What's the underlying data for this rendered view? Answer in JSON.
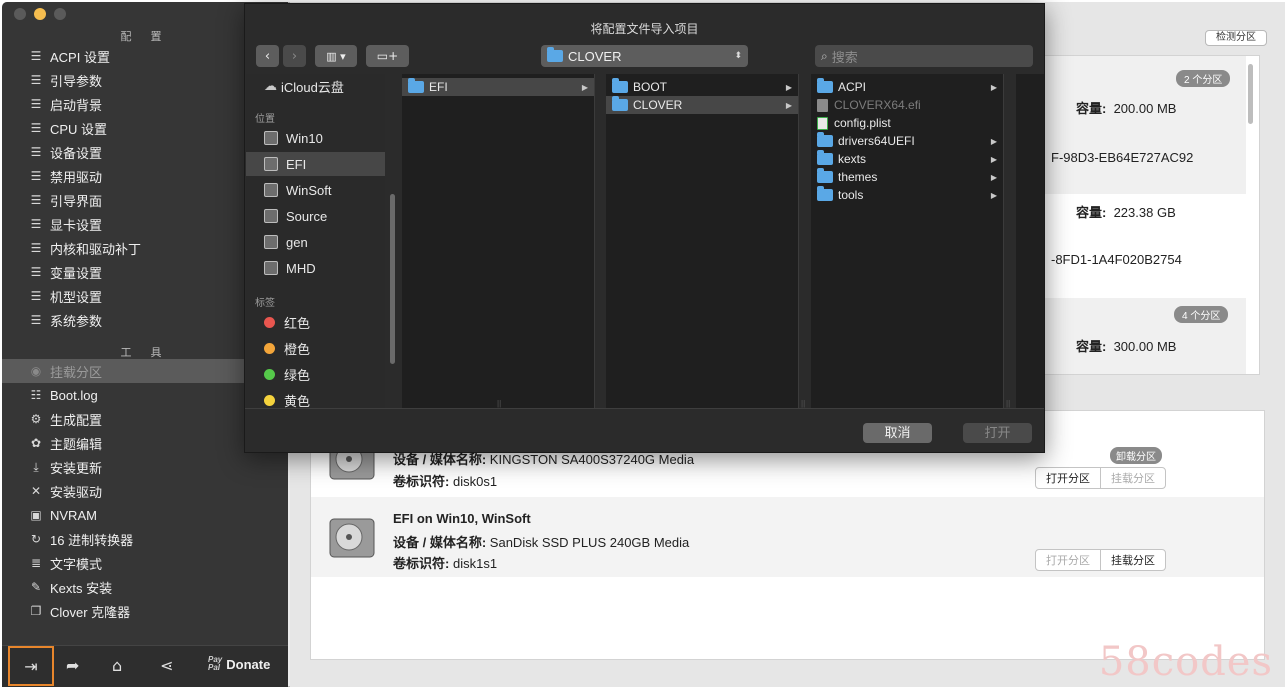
{
  "sidebar": {
    "section_config": "配 置",
    "section_tools": "工 具",
    "config_items": [
      {
        "icon": "list-icon",
        "label": "ACPI 设置"
      },
      {
        "icon": "list-icon",
        "label": "引导参数"
      },
      {
        "icon": "list-icon",
        "label": "启动背景"
      },
      {
        "icon": "list-icon",
        "label": "CPU 设置"
      },
      {
        "icon": "list-icon",
        "label": "设备设置"
      },
      {
        "icon": "list-icon",
        "label": "禁用驱动"
      },
      {
        "icon": "list-icon",
        "label": "引导界面"
      },
      {
        "icon": "list-icon",
        "label": "显卡设置"
      },
      {
        "icon": "list-icon",
        "label": "内核和驱动补丁"
      },
      {
        "icon": "list-icon",
        "label": "变量设置"
      },
      {
        "icon": "list-icon",
        "label": "机型设置"
      },
      {
        "icon": "list-icon",
        "label": "系统参数"
      }
    ],
    "tool_items": [
      {
        "icon": "disk-icon",
        "label": "挂载分区"
      },
      {
        "icon": "log-icon",
        "label": "Boot.log"
      },
      {
        "icon": "gears-icon",
        "label": "生成配置"
      },
      {
        "icon": "palette-icon",
        "label": "主题编辑"
      },
      {
        "icon": "download-icon",
        "label": "安装更新"
      },
      {
        "icon": "tools-icon",
        "label": "安装驱动"
      },
      {
        "icon": "chip-icon",
        "label": "NVRAM"
      },
      {
        "icon": "refresh-icon",
        "label": "16 进制转换器"
      },
      {
        "icon": "text-icon",
        "label": "文字模式"
      },
      {
        "icon": "bolt-icon",
        "label": "Kexts 安装"
      },
      {
        "icon": "clone-icon",
        "label": "Clover 克隆器"
      }
    ],
    "bottom": {
      "paypal_top": "Pay",
      "paypal_bottom": "Pal",
      "donate": "Donate"
    }
  },
  "main": {
    "detect_button": "检测分区",
    "top_rows": [
      {
        "badge": "2 个分区",
        "capacity_label": "容量:",
        "capacity": "200.00 MB",
        "uuid": "F-98D3-EB64E727AC92"
      },
      {
        "capacity_label": "容量:",
        "capacity": "223.38 GB",
        "uuid": "-8FD1-1A4F020B2754"
      },
      {
        "badge": "4 个分区",
        "capacity_label": "容量:",
        "capacity": "300.00 MB"
      }
    ],
    "disks": [
      {
        "title": "",
        "device_label": "设备 / 媒体名称:",
        "device": "KINGSTON SA400S37240G Media",
        "volume_label": "卷标识符:",
        "volume": "disk0s1",
        "badge": "卸载分区",
        "open": "打开分区",
        "mount": "挂载分区"
      },
      {
        "title": "EFI on Win10, WinSoft",
        "device_label": "设备 / 媒体名称:",
        "device": "SanDisk SSD PLUS 240GB Media",
        "volume_label": "卷标识符:",
        "volume": "disk1s1",
        "open": "打开分区",
        "mount": "挂载分区"
      }
    ]
  },
  "dialog": {
    "title": "将配置文件导入项目",
    "path": "CLOVER",
    "search_placeholder": "搜索",
    "sidebar": {
      "icloud": "iCloud云盘",
      "locations_head": "位置",
      "locations": [
        "Win10",
        "EFI",
        "WinSoft",
        "Source",
        "gen",
        "MHD"
      ],
      "tags_head": "标签",
      "tags": [
        {
          "label": "红色",
          "color": "#e9564f"
        },
        {
          "label": "橙色",
          "color": "#f3a53a"
        },
        {
          "label": "绿色",
          "color": "#55c94a"
        },
        {
          "label": "黄色",
          "color": "#f5d33d"
        }
      ]
    },
    "col1": [
      "EFI"
    ],
    "col2": [
      "BOOT",
      "CLOVER"
    ],
    "col3": [
      {
        "name": "ACPI",
        "type": "folder"
      },
      {
        "name": "CLOVERX64.efi",
        "type": "file"
      },
      {
        "name": "config.plist",
        "type": "plist"
      },
      {
        "name": "drivers64UEFI",
        "type": "folder"
      },
      {
        "name": "kexts",
        "type": "folder"
      },
      {
        "name": "themes",
        "type": "folder"
      },
      {
        "name": "tools",
        "type": "folder"
      }
    ],
    "cancel": "取消",
    "open": "打开"
  },
  "watermark": "58codes"
}
